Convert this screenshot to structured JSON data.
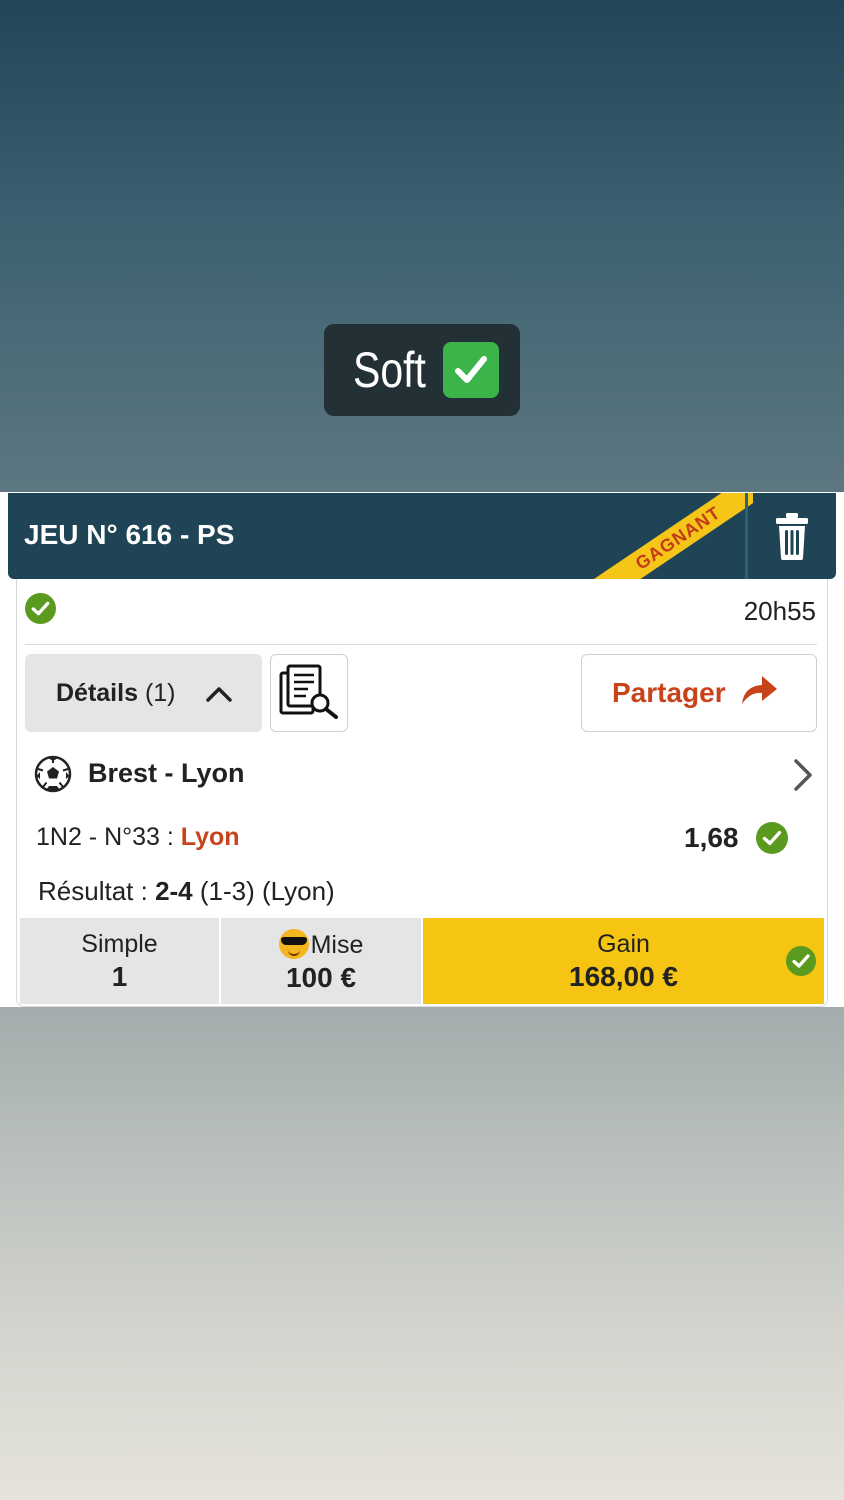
{
  "caption": {
    "text": "Soft",
    "emoji": "check-mark-emoji"
  },
  "header": {
    "title": "JEU N° 616 - PS",
    "ribbon": "GAGNANT",
    "delete_icon": "trash-icon"
  },
  "status": {
    "time": "20h55",
    "icon": "check-circle-icon"
  },
  "actions": {
    "details_label": "Détails",
    "details_count": "(1)",
    "document_icon": "document-search-icon",
    "share_label": "Partager"
  },
  "match": {
    "sport_icon": "soccer-ball-icon",
    "name": "Brest - Lyon",
    "bet_type": "1N2 - N°33 : ",
    "selection": "Lyon",
    "odds": "1,68",
    "result_label": "Résultat : ",
    "result_score": "2-4",
    "result_detail": " (1-3) (Lyon)"
  },
  "summary": {
    "simple_label": "Simple",
    "simple_value": "1",
    "mise_label": "Mise",
    "mise_value": "100 €",
    "gain_label": "Gain",
    "gain_value": "168,00 €"
  },
  "colors": {
    "header_bg": "#1f4455",
    "accent_orange": "#c8431a",
    "gain_yellow": "#f6c412",
    "check_green": "#5a9a1e"
  }
}
